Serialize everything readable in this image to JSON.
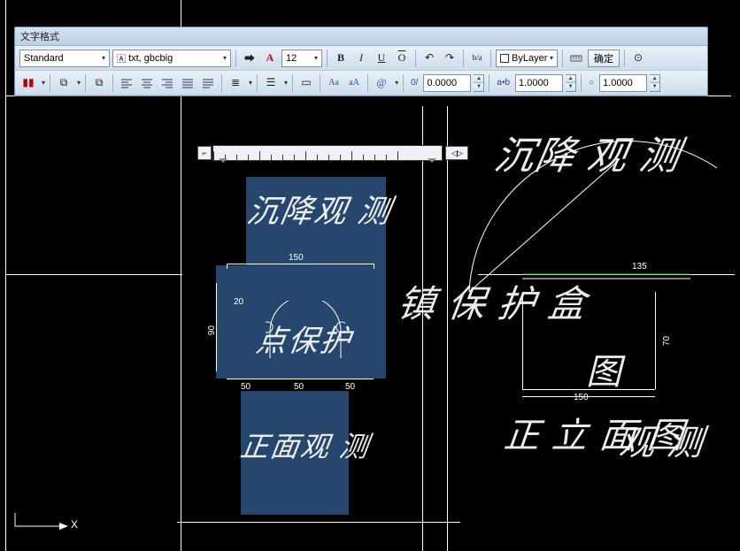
{
  "toolbar": {
    "title": "文字格式",
    "style_combo": "Standard",
    "font_combo": "txt, gbcbig",
    "size_value": "12",
    "color_label": "A",
    "bold_label": "B",
    "italic_label": "I",
    "underline_label": "U",
    "overline_label": "O",
    "undo_label": "↶",
    "redo_label": "↷",
    "fraction_label": "b/a",
    "bylayer_label": "ByLayer",
    "confirm_label": "确定",
    "options_label": "⊙"
  },
  "row2": {
    "case_upper": "Aa",
    "case_lower": "aA",
    "at_label": "@",
    "oblique_label": "0/",
    "oblique_value": "0.0000",
    "tracking_label": "a•b",
    "tracking_value": "1.0000",
    "width_label": "○",
    "width_value": "1.0000"
  },
  "ruler": {
    "left_icon": "⌐",
    "arrows": "◁▷"
  },
  "canvas_text": {
    "t1": "沉降 观 测",
    "t2": "沉降观 测",
    "t3": "镇 保 护 盒",
    "t4": "正 立 面 图",
    "t5": "观 测",
    "t6": "点保护",
    "t7": "图",
    "t8": "正面观 测",
    "dim150": "150",
    "dim90": "90",
    "dim20": "20",
    "dim50a": "50",
    "dim50b": "50",
    "dim50c": "50",
    "dim70": "70",
    "dim135": "135",
    "dim150b": "150"
  },
  "ucs": {
    "x": "X"
  }
}
